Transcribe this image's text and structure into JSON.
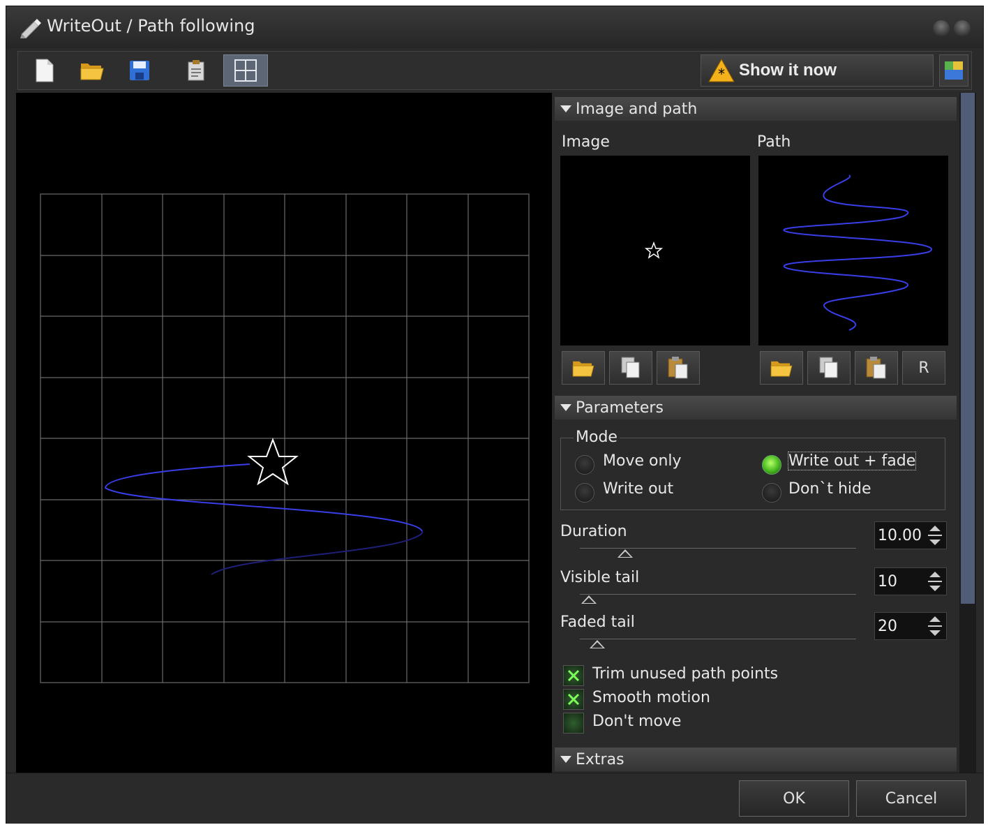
{
  "window": {
    "title": "WriteOut / Path following"
  },
  "toolbar": {
    "buttons": [
      "new-file-icon",
      "open-folder-icon",
      "save-disk-icon",
      "clipboard-icon",
      "grid-icon"
    ],
    "show_now_label": "Show it now"
  },
  "sections": {
    "image_and_path": {
      "title": "Image and path",
      "image_label": "Image",
      "path_label": "Path",
      "reset_label": "R"
    },
    "parameters": {
      "title": "Parameters",
      "mode": {
        "label": "Mode",
        "options": [
          "Move only",
          "Write out + fade",
          "Write out",
          "Don`t hide"
        ],
        "selected": "Write out + fade"
      },
      "duration": {
        "label": "Duration",
        "value": "10.00"
      },
      "visible_tail": {
        "label": "Visible tail",
        "value": "10"
      },
      "faded_tail": {
        "label": "Faded tail",
        "value": "20"
      },
      "checkboxes": [
        {
          "label": "Trim unused path points",
          "checked": true
        },
        {
          "label": "Smooth motion",
          "checked": true
        },
        {
          "label": "Don't move",
          "checked": false
        }
      ]
    },
    "extras": {
      "title": "Extras"
    }
  },
  "dialog": {
    "ok_label": "OK",
    "cancel_label": "Cancel"
  },
  "colors": {
    "path_blue": "#3a3ee8",
    "radio_on": "#5fd12a",
    "scroll_thumb": "#515d78"
  }
}
